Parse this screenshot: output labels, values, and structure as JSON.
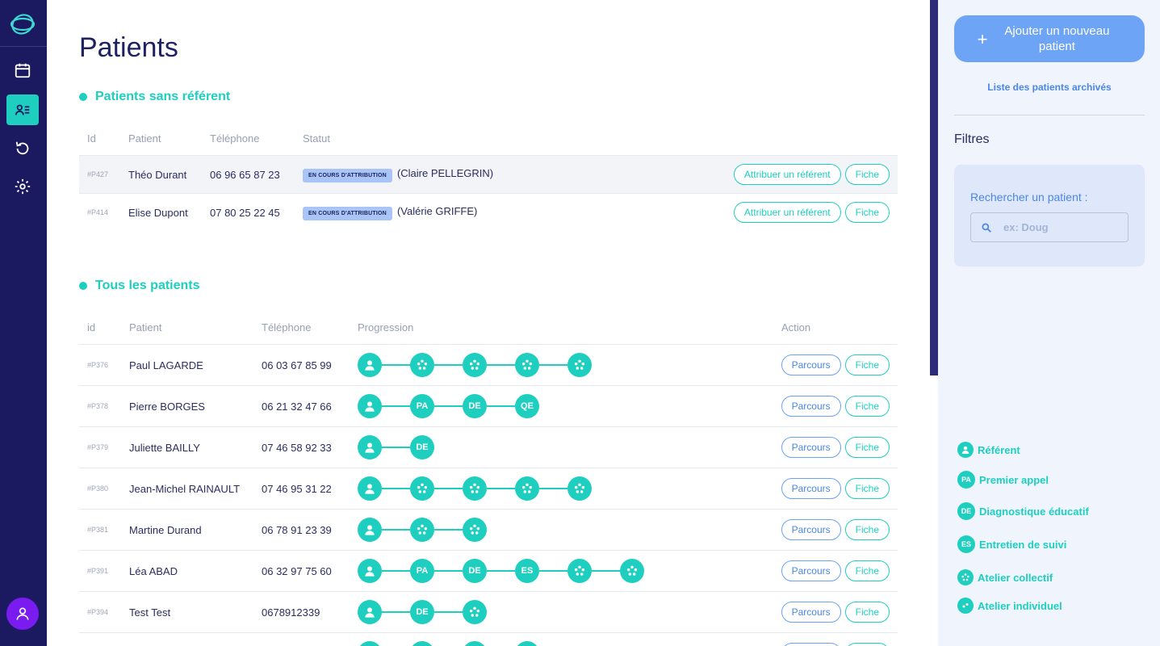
{
  "sidebar": {
    "nav": [
      {
        "icon": "calendar-icon"
      },
      {
        "icon": "patients-list-icon",
        "active": true
      },
      {
        "icon": "refresh-icon"
      },
      {
        "icon": "gear-icon"
      }
    ],
    "avatar_icon": "user-icon"
  },
  "page": {
    "title": "Patients"
  },
  "unassigned": {
    "title": "Patients sans référent",
    "headers": {
      "id": "Id",
      "patient": "Patient",
      "phone": "Téléphone",
      "status": "Statut"
    },
    "rows": [
      {
        "id": "#P427",
        "name": "Théo Durant",
        "phone": "06 96 65 87 23",
        "status": "EN COURS D'ATTRIBUTION",
        "referent": "(Claire PELLEGRIN)",
        "assign_label": "Attribuer un référent",
        "sheet_label": "Fiche"
      },
      {
        "id": "#P414",
        "name": "Elise Dupont",
        "phone": "07 80 25 22 45",
        "status": "EN COURS D'ATTRIBUTION",
        "referent": "(Valérie GRIFFE)",
        "assign_label": "Attribuer un référent",
        "sheet_label": "Fiche"
      }
    ]
  },
  "all": {
    "title": "Tous les patients",
    "headers": {
      "id": "id",
      "patient": "Patient",
      "phone": "Téléphone",
      "progress": "Progression",
      "action": "Action"
    },
    "course_label": "Parcours",
    "sheet_label": "Fiche",
    "rows": [
      {
        "id": "#P376",
        "name": "Paul LAGARDE",
        "phone": "06 03 67 85 99",
        "steps": [
          "R",
          "AC",
          "AC",
          "AC",
          "AC"
        ]
      },
      {
        "id": "#P378",
        "name": "Pierre BORGES",
        "phone": "06 21 32 47 66",
        "steps": [
          "R",
          "PA",
          "DE",
          "QE"
        ]
      },
      {
        "id": "#P379",
        "name": "Juliette BAILLY",
        "phone": "07 46 58 92 33",
        "steps": [
          "R",
          "DE"
        ]
      },
      {
        "id": "#P380",
        "name": "Jean-Michel RAINAULT",
        "phone": "07 46 95 31 22",
        "steps": [
          "R",
          "AC",
          "AC",
          "AC",
          "AC"
        ]
      },
      {
        "id": "#P381",
        "name": "Martine Durand",
        "phone": "06 78 91 23 39",
        "steps": [
          "R",
          "AC",
          "AC"
        ]
      },
      {
        "id": "#P391",
        "name": "Léa ABAD",
        "phone": "06 32 97 75 60",
        "steps": [
          "R",
          "PA",
          "DE",
          "ES",
          "AC",
          "AC"
        ]
      },
      {
        "id": "#P394",
        "name": "Test Test",
        "phone": "0678912339",
        "steps": [
          "R",
          "DE",
          "AC"
        ]
      },
      {
        "id": "",
        "name": "",
        "phone": "",
        "steps": [
          "R",
          "R",
          "R",
          "R"
        ]
      }
    ]
  },
  "right_panel": {
    "add_button": "Ajouter un nouveau patient",
    "archive_link": "Liste des patients archivés",
    "filters_title": "Filtres",
    "search_label": "Rechercher un patient :",
    "search_placeholder": "ex: Doug",
    "search_value": ""
  },
  "legend": [
    {
      "code": "R",
      "label": "Référent"
    },
    {
      "code": "PA",
      "label": "Premier appel"
    },
    {
      "code": "DE",
      "label": "Diagnostique éducatif"
    },
    {
      "code": "ES",
      "label": "Entretien de suivi"
    },
    {
      "code": "AC",
      "label": "Atelier collectif"
    },
    {
      "code": "AI",
      "label": "Atelier individuel"
    }
  ],
  "colors": {
    "sidebar": "#1b1a60",
    "accent": "#1ecfc0",
    "blue": "#6ea4f5",
    "panel": "#eff4fd",
    "avatar": "#7a1cf0"
  }
}
